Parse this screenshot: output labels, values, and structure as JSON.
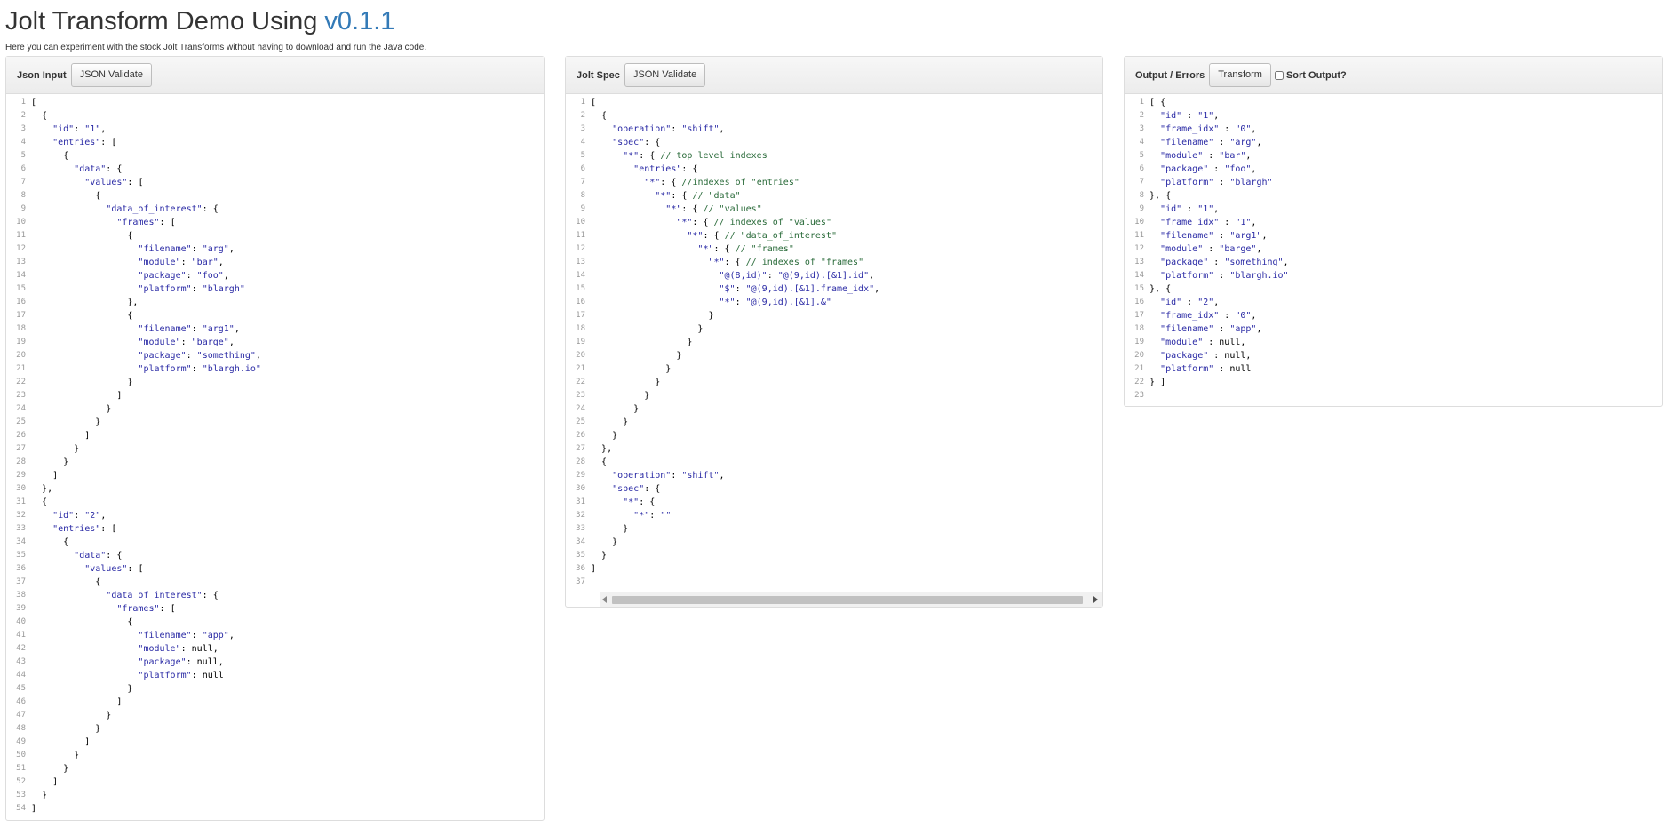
{
  "header": {
    "title": "Jolt Transform Demo Using ",
    "version": "v0.1.1",
    "subtitle": "Here you can experiment with the stock Jolt Transforms without having to download and run the Java code."
  },
  "panels": {
    "input": {
      "title": "Json Input",
      "button": "JSON Validate"
    },
    "spec": {
      "title": "Jolt Spec",
      "button": "JSON Validate"
    },
    "output": {
      "title": "Output / Errors",
      "button": "Transform",
      "checkbox_label": "Sort Output?",
      "checkbox_checked": false
    }
  },
  "editors": {
    "input": [
      "[",
      "  {",
      "    \"id\": \"1\",",
      "    \"entries\": [",
      "      {",
      "        \"data\": {",
      "          \"values\": [",
      "            {",
      "              \"data_of_interest\": {",
      "                \"frames\": [",
      "                  {",
      "                    \"filename\": \"arg\",",
      "                    \"module\": \"bar\",",
      "                    \"package\": \"foo\",",
      "                    \"platform\": \"blargh\"",
      "                  },",
      "                  {",
      "                    \"filename\": \"arg1\",",
      "                    \"module\": \"barge\",",
      "                    \"package\": \"something\",",
      "                    \"platform\": \"blargh.io\"",
      "                  }",
      "                ]",
      "              }",
      "            }",
      "          ]",
      "        }",
      "      }",
      "    ]",
      "  },",
      "  {",
      "    \"id\": \"2\",",
      "    \"entries\": [",
      "      {",
      "        \"data\": {",
      "          \"values\": [",
      "            {",
      "              \"data_of_interest\": {",
      "                \"frames\": [",
      "                  {",
      "                    \"filename\": \"app\",",
      "                    \"module\": null,",
      "                    \"package\": null,",
      "                    \"platform\": null",
      "                  }",
      "                ]",
      "              }",
      "            }",
      "          ]",
      "        }",
      "      }",
      "    ]",
      "  }",
      "]"
    ],
    "spec": [
      "[",
      "  {",
      "    \"operation\": \"shift\",",
      "    \"spec\": {",
      "      \"*\": { // top level indexes",
      "        \"entries\": {",
      "          \"*\": { //indexes of \"entries\"",
      "            \"*\": { // \"data\"",
      "              \"*\": { // \"values\"",
      "                \"*\": { // indexes of \"values\"",
      "                  \"*\": { // \"data_of_interest\"",
      "                    \"*\": { // \"frames\"",
      "                      \"*\": { // indexes of \"frames\"",
      "                        \"@(8,id)\": \"@(9,id).[&1].id\",",
      "                        \"$\": \"@(9,id).[&1].frame_idx\",",
      "                        \"*\": \"@(9,id).[&1].&\"",
      "                      }",
      "                    }",
      "                  }",
      "                }",
      "              }",
      "            }",
      "          }",
      "        }",
      "      }",
      "    }",
      "  },",
      "  {",
      "    \"operation\": \"shift\",",
      "    \"spec\": {",
      "      \"*\": {",
      "        \"*\": \"\"",
      "      }",
      "    }",
      "  }",
      "]",
      ""
    ],
    "output": [
      "[ {",
      "  \"id\" : \"1\",",
      "  \"frame_idx\" : \"0\",",
      "  \"filename\" : \"arg\",",
      "  \"module\" : \"bar\",",
      "  \"package\" : \"foo\",",
      "  \"platform\" : \"blargh\"",
      "}, {",
      "  \"id\" : \"1\",",
      "  \"frame_idx\" : \"1\",",
      "  \"filename\" : \"arg1\",",
      "  \"module\" : \"barge\",",
      "  \"package\" : \"something\",",
      "  \"platform\" : \"blargh.io\"",
      "}, {",
      "  \"id\" : \"2\",",
      "  \"frame_idx\" : \"0\",",
      "  \"filename\" : \"app\",",
      "  \"module\" : null,",
      "  \"package\" : null,",
      "  \"platform\" : null",
      "} ]",
      ""
    ]
  }
}
